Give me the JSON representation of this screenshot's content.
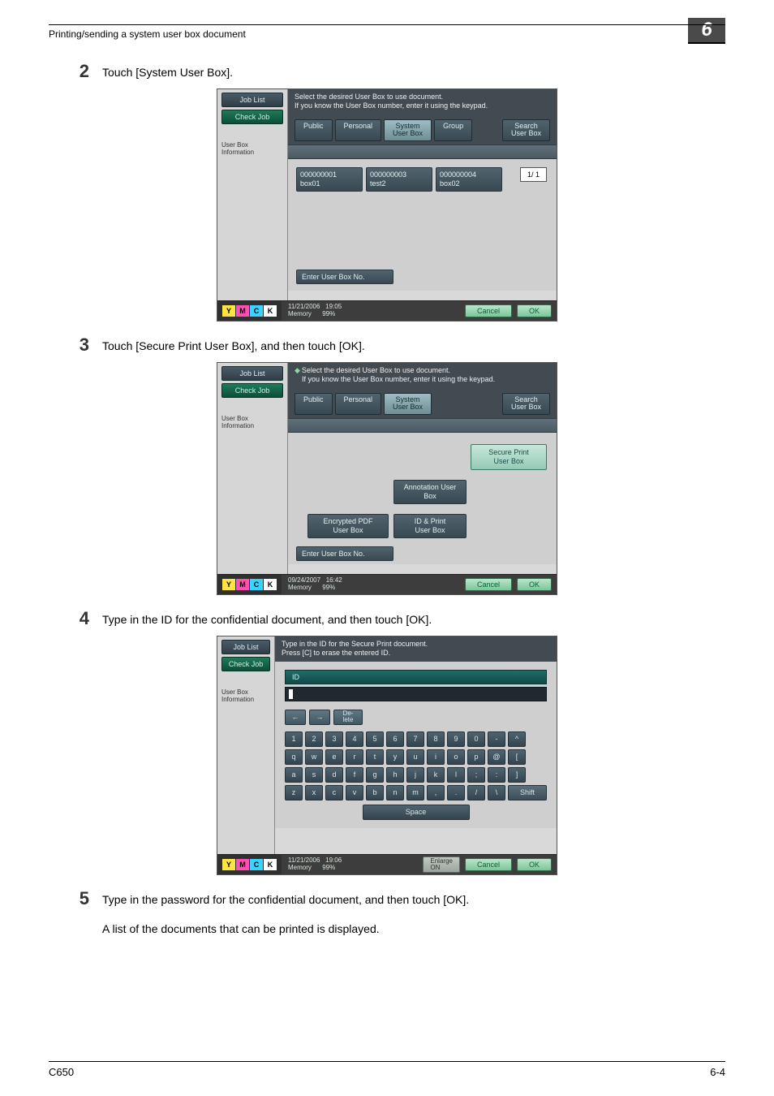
{
  "header": {
    "title": "Printing/sending a system user box document"
  },
  "page_badge": "6",
  "steps": {
    "s2": {
      "num": "2",
      "text": "Touch [System User Box]."
    },
    "s3": {
      "num": "3",
      "text": "Touch [Secure Print User Box], and then touch [OK]."
    },
    "s4": {
      "num": "4",
      "text": "Type in the ID for the confidential document, and then touch [OK]."
    },
    "s5": {
      "num": "5",
      "text": "Type in the password for the confidential document, and then touch [OK].",
      "sub": "A list of the documents that can be printed is displayed."
    }
  },
  "shot_common": {
    "left": {
      "job_list": "Job List",
      "check_job": "Check Job",
      "info": "User Box\nInformation"
    },
    "tabs": {
      "public": "Public",
      "personal": "Personal",
      "system": "System\nUser Box",
      "group": "Group",
      "search": "Search\nUser Box"
    },
    "enter": "Enter User Box No.",
    "foot": {
      "cancel": "Cancel",
      "ok": "OK",
      "memory_label": "Memory",
      "memory_val": "99%",
      "enlarge": "Enlarge\nON"
    }
  },
  "shot1": {
    "instr1": "Select the desired User Box to use document.",
    "instr2": "If you know the User Box number, enter it using the keypad.",
    "boxes": [
      {
        "id": "000000001",
        "name": "box01"
      },
      {
        "id": "000000003",
        "name": "test2"
      },
      {
        "id": "000000004",
        "name": "box02"
      }
    ],
    "page_ind": "1/  1",
    "date": "11/21/2006",
    "time": "19:05"
  },
  "shot2": {
    "instr1": "Select the desired User Box to use document.",
    "instr2": "If you know the User Box number, enter it using the keypad.",
    "secure": "Secure Print\nUser Box",
    "annotation": "Annotation\nUser Box",
    "encpdf": "Encrypted PDF\nUser Box",
    "idprint": "ID & Print\nUser Box",
    "date": "09/24/2007",
    "time": "16:42"
  },
  "shot3": {
    "instr1": "Type in the ID for the Secure Print document.",
    "instr2": "Press [C] to erase the entered ID.",
    "id_label": "ID",
    "nav": {
      "left": "←",
      "right": "→",
      "delete": "De-\nlete"
    },
    "row1": [
      "1",
      "2",
      "3",
      "4",
      "5",
      "6",
      "7",
      "8",
      "9",
      "0",
      "-",
      "^"
    ],
    "row2": [
      "q",
      "w",
      "e",
      "r",
      "t",
      "y",
      "u",
      "i",
      "o",
      "p",
      "@",
      "["
    ],
    "row3": [
      "a",
      "s",
      "d",
      "f",
      "g",
      "h",
      "j",
      "k",
      "l",
      ";",
      ":",
      "]"
    ],
    "row4": [
      "z",
      "x",
      "c",
      "v",
      "b",
      "n",
      "m",
      ",",
      ".",
      "/",
      "\\"
    ],
    "shift": "Shift",
    "space": "Space",
    "date": "11/21/2006",
    "time": "19:06"
  },
  "footer": {
    "left": "C650",
    "right": "6-4"
  }
}
